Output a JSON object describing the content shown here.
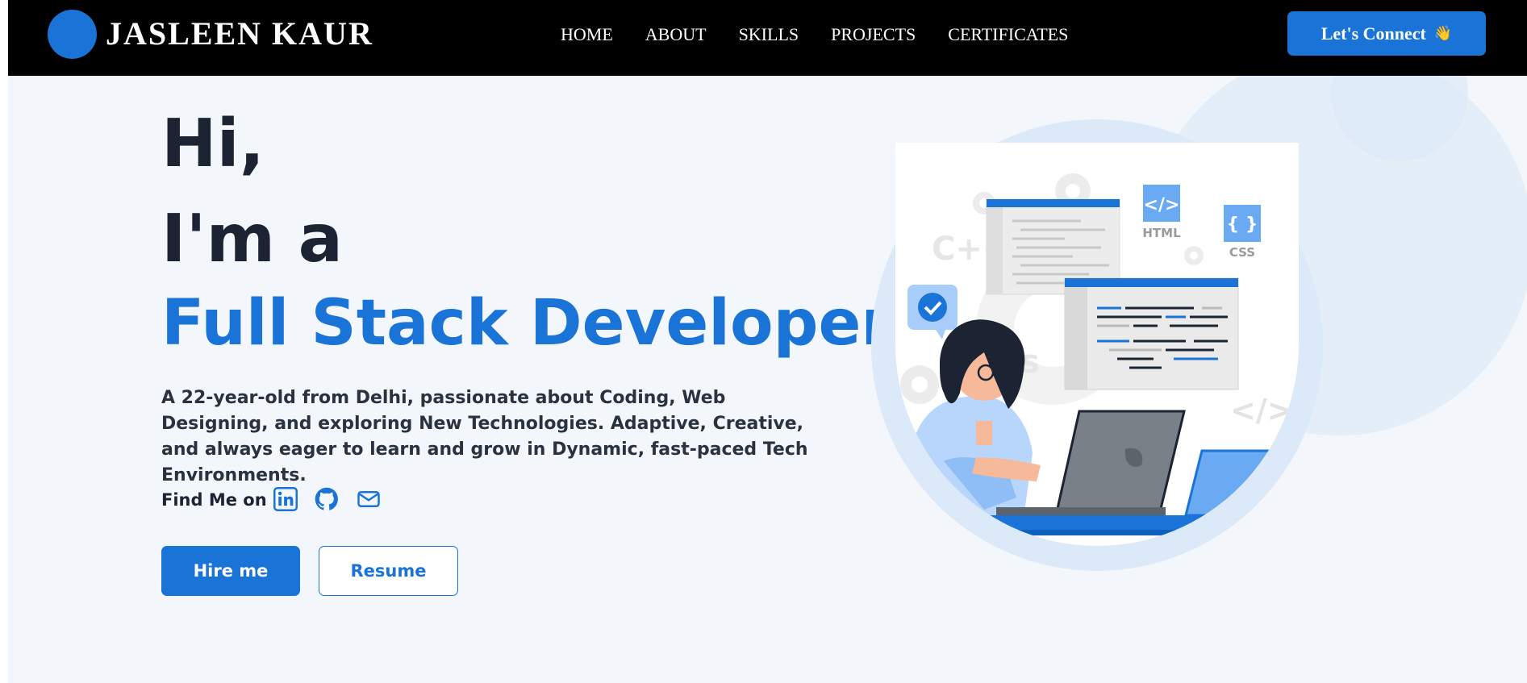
{
  "nav": {
    "brand": "JASLEEN KAUR",
    "links": [
      "HOME",
      "ABOUT",
      "SKILLS",
      "PROJECTS",
      "CERTIFICATES"
    ],
    "cta": "Let's Connect",
    "cta_emoji": "👋"
  },
  "hero": {
    "greeting": "Hi,",
    "intro": "I'm a",
    "role": "Full Stack Developer",
    "description": "A 22-year-old from Delhi, passionate about Coding, Web Designing, and exploring New Technologies. Adaptive, Creative, and always eager to learn and grow in Dynamic, fast-paced Tech Environments.",
    "find_label": "Find Me on",
    "social_icons": [
      "linkedin-icon",
      "github-icon",
      "mail-icon"
    ],
    "hire_label": "Hire me",
    "resume_label": "Resume"
  },
  "illustration": {
    "html_label": "HTML",
    "css_label": "CSS",
    "html_tag": "</>",
    "css_tag": "{ }",
    "cpp_label": "C++",
    "js_label": "Js",
    "code_tag": "</>"
  },
  "colors": {
    "accent": "#1a73d6",
    "dark_text": "#1c2434",
    "nav_bg": "#000000",
    "page_bg": "#f3f7fc"
  }
}
